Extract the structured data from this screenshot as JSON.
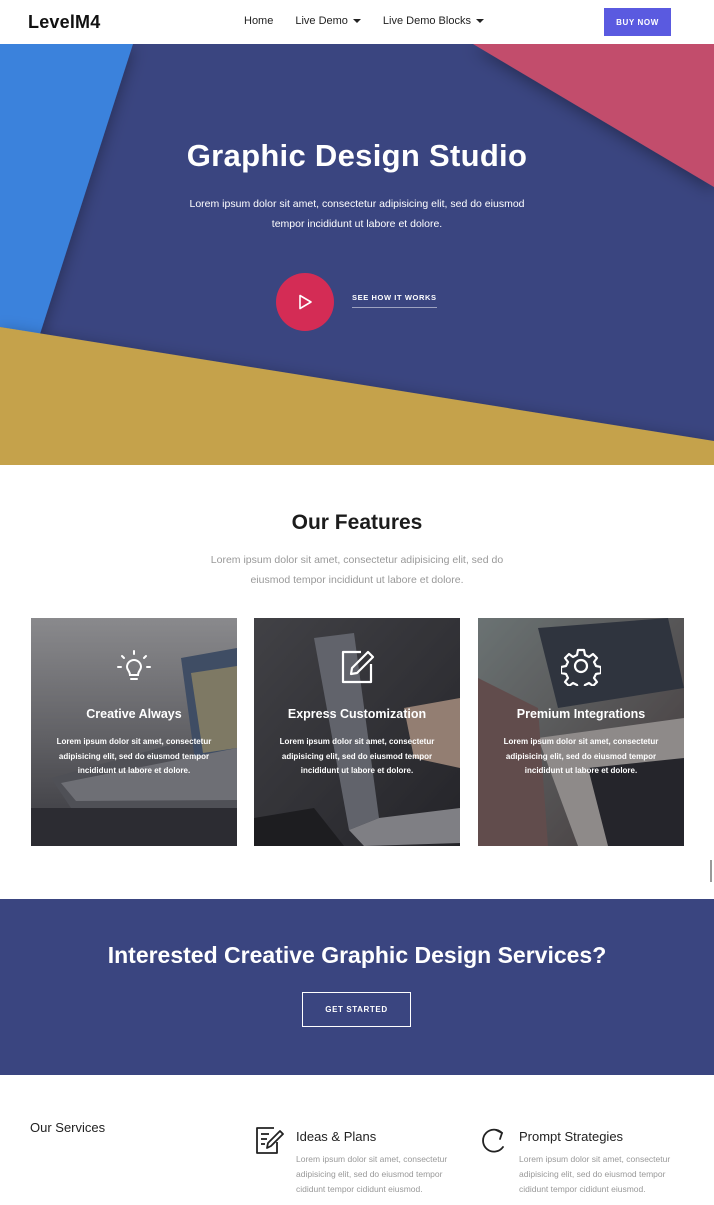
{
  "nav": {
    "logo": "LevelM4",
    "items": [
      {
        "label": "Home",
        "dropdown": false
      },
      {
        "label": "Live Demo",
        "dropdown": true
      },
      {
        "label": "Live Demo Blocks",
        "dropdown": true
      }
    ],
    "buy_label": "BUY NOW",
    "colors": {
      "buy_bg": "#5a5ae0"
    }
  },
  "hero": {
    "title": "Graphic Design Studio",
    "subtitle": "Lorem ipsum dolor sit amet, consectetur adipisicing elit, sed do eiusmod tempor incididunt ut labore et dolore.",
    "play_icon": "play-icon",
    "see_label": "SEE HOW IT WORKS",
    "colors": {
      "base": "#3a4580",
      "blue": "#3a82dc",
      "pink": "#c24d6c",
      "gold": "#c5a24c",
      "play": "#d42c55"
    }
  },
  "features": {
    "title": "Our Features",
    "subtitle": "Lorem ipsum dolor sit amet, consectetur adipisicing elit, sed do eiusmod tempor incididunt ut labore et dolore.",
    "cards": [
      {
        "icon": "lightbulb-icon",
        "title": "Creative Always",
        "text": "Lorem ipsum dolor sit amet, consectetur adipisicing elit, sed do eiusmod tempor incididunt ut labore et dolore."
      },
      {
        "icon": "edit-icon",
        "title": "Express Customization",
        "text": "Lorem ipsum dolor sit amet, consectetur adipisicing elit, sed do eiusmod tempor incididunt ut labore et dolore."
      },
      {
        "icon": "gear-icon",
        "title": "Premium Integrations",
        "text": "Lorem ipsum dolor sit amet, consectetur adipisicing elit, sed do eiusmod tempor incididunt ut labore et dolore."
      }
    ]
  },
  "cta": {
    "title": "Interested Creative Graphic Design Services?",
    "button": "GET STARTED"
  },
  "services": {
    "title": "Our Services",
    "items": [
      {
        "icon": "document-edit-icon",
        "name": "Ideas & Plans",
        "text": "Lorem ipsum dolor sit amet, consectetur adipisicing elit, sed do eiusmod tempor cididunt tempor cididunt eiusmod."
      },
      {
        "icon": "refresh-icon",
        "name": "Prompt Strategies",
        "text": "Lorem ipsum dolor sit amet, consectetur adipisicing elit, sed do eiusmod tempor cididunt tempor cididunt eiusmod."
      }
    ]
  }
}
